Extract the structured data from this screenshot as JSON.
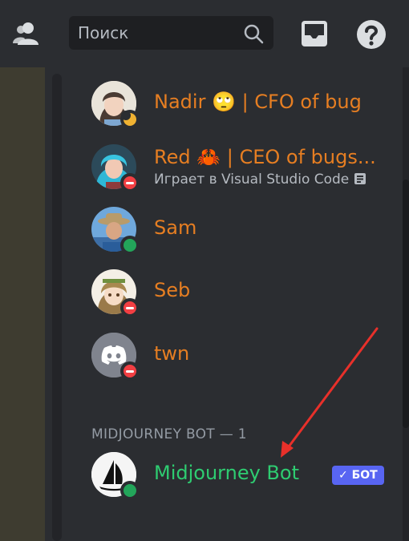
{
  "search": {
    "placeholder": "Поиск"
  },
  "members": [
    {
      "name": "Nadir 🙄 | CFO of bug",
      "status": "idle"
    },
    {
      "name": "Red 🦀 | CEO of bugs...",
      "activity": "Играет в Visual Studio Code",
      "status": "dnd"
    },
    {
      "name": "Sam",
      "status": "online"
    },
    {
      "name": "Seb",
      "status": "dnd"
    },
    {
      "name": "twn",
      "status": "dnd"
    }
  ],
  "section": {
    "title": "MIDJOURNEY BOT — 1"
  },
  "bot": {
    "name": "Midjourney Bot",
    "tag": "✓ БОТ",
    "status": "online"
  },
  "colors": {
    "accent_orange": "#e67e22",
    "bot_green": "#2ecc71",
    "bot_tag": "#5865f2",
    "annotation_arrow": "#e8302a"
  }
}
